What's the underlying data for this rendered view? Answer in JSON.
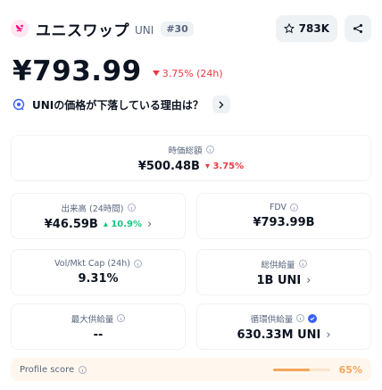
{
  "header": {
    "coin_name": "ユニスワップ",
    "symbol": "UNI",
    "rank": "#30",
    "watchlist_count": "783K",
    "brand_color": "#ff007a"
  },
  "price": {
    "value": "¥793.99",
    "change": "3.75% (24h)",
    "direction": "down"
  },
  "ask": {
    "question": "UNIの価格が下落している理由は？"
  },
  "stats": {
    "market_cap": {
      "label": "時価総額",
      "value": "¥500.48B",
      "change": "3.75%"
    },
    "volume": {
      "label": "出来高 (24時間)",
      "value": "¥46.59B",
      "change": "10.9%"
    },
    "fdv": {
      "label": "FDV",
      "value": "¥793.99B"
    },
    "vol_mkt_cap": {
      "label": "Vol/Mkt Cap (24h)",
      "value": "9.31%"
    },
    "total_supply": {
      "label": "総供給量",
      "value": "1B UNI"
    },
    "max_supply": {
      "label": "最大供給量",
      "value": "--"
    },
    "circulating_supply": {
      "label": "循環供給量",
      "value": "630.33M UNI"
    }
  },
  "profile": {
    "label": "Profile score",
    "value": "65%",
    "fraction": 0.65
  }
}
